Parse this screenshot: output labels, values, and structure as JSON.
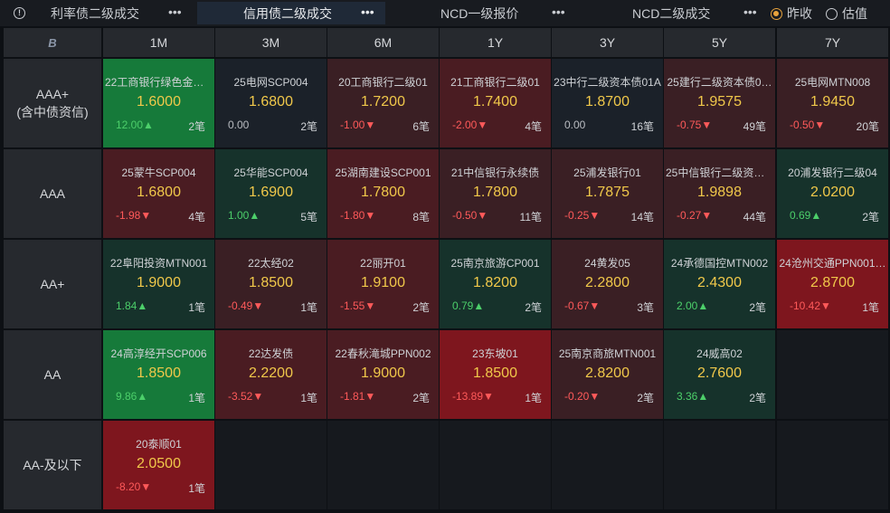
{
  "tabs": [
    {
      "label": "利率债二级成交",
      "dots": "•••"
    },
    {
      "label": "信用债二级成交",
      "dots": "•••"
    },
    {
      "label": "NCD一级报价",
      "dots": "•••"
    },
    {
      "label": "NCD二级成交",
      "dots": "•••"
    }
  ],
  "radios": [
    {
      "label": "昨收",
      "checked": true
    },
    {
      "label": "估值",
      "checked": false
    }
  ],
  "corner_icon": "B",
  "columns": [
    "1M",
    "3M",
    "6M",
    "1Y",
    "3Y",
    "5Y",
    "7Y"
  ],
  "rows": [
    {
      "label_line1": "AAA+",
      "label_line2": "(含中债资信)"
    },
    {
      "label_line1": "AAA",
      "label_line2": ""
    },
    {
      "label_line1": "AA+",
      "label_line2": ""
    },
    {
      "label_line1": "AA",
      "label_line2": ""
    },
    {
      "label_line1": "AA-及以下",
      "label_line2": ""
    }
  ],
  "colors": {
    "green": "#167a3a",
    "dark_green": "#16322b",
    "neutral": "#1b2129",
    "dark_red": "#3a1f24",
    "mid_red": "#4a1c22",
    "red": "#7e161e",
    "empty": "#16191e"
  },
  "cells": [
    [
      {
        "name": "22工商银行绿色金融…",
        "price": "1.6000",
        "change": "12.00",
        "dir": "up",
        "count": "2笔",
        "color": "green"
      },
      {
        "name": "25电网SCP004",
        "price": "1.6800",
        "change": "0.00",
        "dir": "flat",
        "count": "2笔",
        "color": "neutral"
      },
      {
        "name": "20工商银行二级01",
        "price": "1.7200",
        "change": "-1.00",
        "dir": "down",
        "count": "6笔",
        "color": "dark_red"
      },
      {
        "name": "21工商银行二级01",
        "price": "1.7400",
        "change": "-2.00",
        "dir": "down",
        "count": "4笔",
        "color": "mid_red"
      },
      {
        "name": "23中行二级资本债01A",
        "price": "1.8700",
        "change": "0.00",
        "dir": "flat",
        "count": "16笔",
        "color": "neutral"
      },
      {
        "name": "25建行二级资本债0…",
        "price": "1.9575",
        "change": "-0.75",
        "dir": "down",
        "count": "49笔",
        "color": "dark_red"
      },
      {
        "name": "25电网MTN008",
        "price": "1.9450",
        "change": "-0.50",
        "dir": "down",
        "count": "20笔",
        "color": "dark_red"
      }
    ],
    [
      {
        "name": "25蒙牛SCP004",
        "price": "1.6800",
        "change": "-1.98",
        "dir": "down",
        "count": "4笔",
        "color": "mid_red"
      },
      {
        "name": "25华能SCP004",
        "price": "1.6900",
        "change": "1.00",
        "dir": "up",
        "count": "5笔",
        "color": "dark_green"
      },
      {
        "name": "25湖南建设SCP001",
        "price": "1.7800",
        "change": "-1.80",
        "dir": "down",
        "count": "8笔",
        "color": "mid_red"
      },
      {
        "name": "21中信银行永续债",
        "price": "1.7800",
        "change": "-0.50",
        "dir": "down",
        "count": "11笔",
        "color": "dark_red"
      },
      {
        "name": "25浦发银行01",
        "price": "1.7875",
        "change": "-0.25",
        "dir": "down",
        "count": "14笔",
        "color": "dark_red"
      },
      {
        "name": "25中信银行二级资本…",
        "price": "1.9898",
        "change": "-0.27",
        "dir": "down",
        "count": "44笔",
        "color": "dark_red"
      },
      {
        "name": "20浦发银行二级04",
        "price": "2.0200",
        "change": "0.69",
        "dir": "up",
        "count": "2笔",
        "color": "dark_green"
      }
    ],
    [
      {
        "name": "22阜阳投资MTN001",
        "price": "1.9000",
        "change": "1.84",
        "dir": "up",
        "count": "1笔",
        "color": "dark_green"
      },
      {
        "name": "22太经02",
        "price": "1.8500",
        "change": "-0.49",
        "dir": "down",
        "count": "1笔",
        "color": "dark_red"
      },
      {
        "name": "22丽开01",
        "price": "1.9100",
        "change": "-1.55",
        "dir": "down",
        "count": "2笔",
        "color": "mid_red"
      },
      {
        "name": "25南京旅游CP001",
        "price": "1.8200",
        "change": "0.79",
        "dir": "up",
        "count": "2笔",
        "color": "dark_green"
      },
      {
        "name": "24黄发05",
        "price": "2.2800",
        "change": "-0.67",
        "dir": "down",
        "count": "3笔",
        "color": "dark_red"
      },
      {
        "name": "24承德国控MTN002",
        "price": "2.4300",
        "change": "2.00",
        "dir": "up",
        "count": "2笔",
        "color": "dark_green"
      },
      {
        "name": "24沧州交通PPN001…",
        "price": "2.8700",
        "change": "-10.42",
        "dir": "down",
        "count": "1笔",
        "color": "red"
      }
    ],
    [
      {
        "name": "24高淳经开SCP006",
        "price": "1.8500",
        "change": "9.86",
        "dir": "up",
        "count": "1笔",
        "color": "green"
      },
      {
        "name": "22达发债",
        "price": "2.2200",
        "change": "-3.52",
        "dir": "down",
        "count": "1笔",
        "color": "mid_red"
      },
      {
        "name": "22春秋滝城PPN002",
        "price": "1.9000",
        "change": "-1.81",
        "dir": "down",
        "count": "2笔",
        "color": "mid_red"
      },
      {
        "name": "23东坡01",
        "price": "1.8500",
        "change": "-13.89",
        "dir": "down",
        "count": "1笔",
        "color": "red"
      },
      {
        "name": "25南京商旅MTN001",
        "price": "2.8200",
        "change": "-0.20",
        "dir": "down",
        "count": "2笔",
        "color": "dark_red"
      },
      {
        "name": "24威高02",
        "price": "2.7600",
        "change": "3.36",
        "dir": "up",
        "count": "2笔",
        "color": "dark_green"
      },
      null
    ],
    [
      {
        "name": "20泰顺01",
        "price": "2.0500",
        "change": "-8.20",
        "dir": "down",
        "count": "1笔",
        "color": "red"
      },
      null,
      null,
      null,
      null,
      null,
      null
    ]
  ]
}
